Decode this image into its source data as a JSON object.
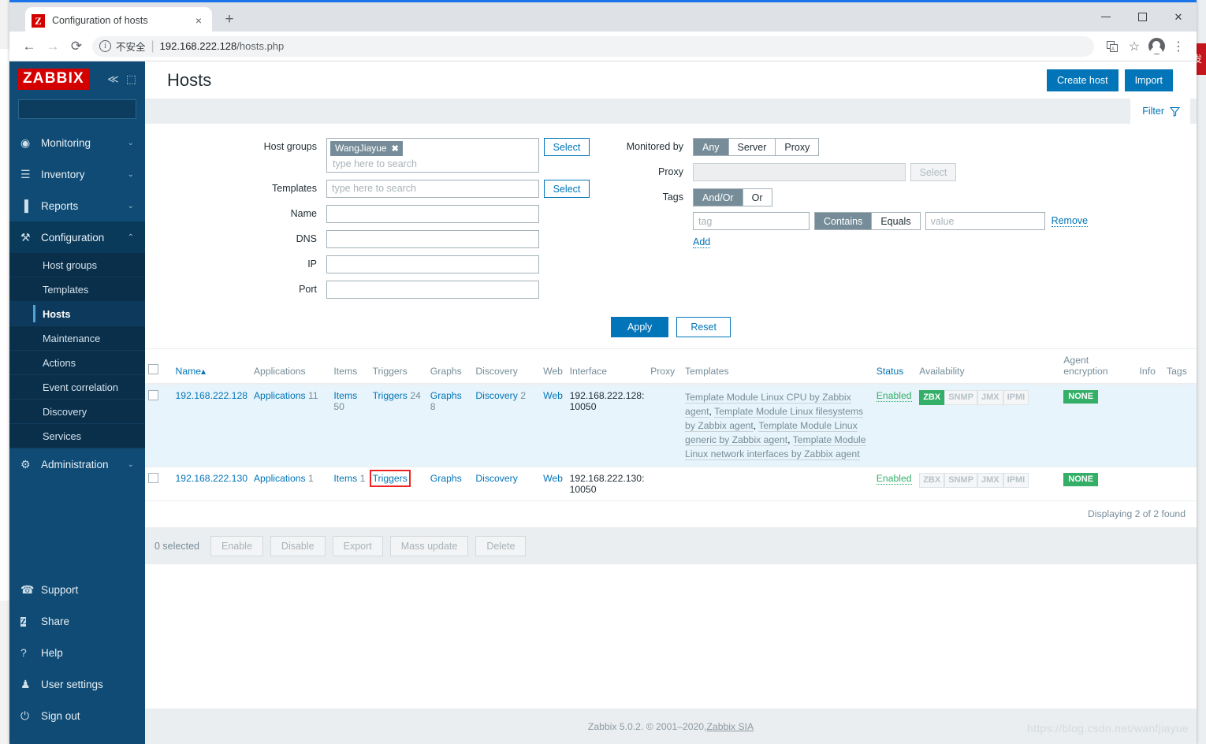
{
  "browser": {
    "tab_title": "Configuration of hosts",
    "tab_favicon": "Z",
    "close_tab": "×",
    "new_tab": "+",
    "back": "←",
    "forward": "→",
    "reload": "⟳",
    "info_icon": "i",
    "security_label": "不安全",
    "url_host": "192.168.222.128",
    "url_path": "/hosts.php",
    "translate_icon": "translate-icon",
    "bookmark_icon": "☆",
    "menu_icon": "⋮",
    "minimize": "—",
    "maximize": "□",
    "close": "✕"
  },
  "sidebar": {
    "logo": "ZABBIX",
    "collapse_icon": "≪",
    "hide_icon": "⬚",
    "search_placeholder": "",
    "search_value": "",
    "search_icon": "⌕",
    "items": [
      {
        "label": "Monitoring",
        "icon": "◉",
        "chevron": "⌄"
      },
      {
        "label": "Inventory",
        "icon": "☰",
        "chevron": "⌄"
      },
      {
        "label": "Reports",
        "icon": "▐",
        "chevron": "⌄"
      },
      {
        "label": "Configuration",
        "icon": "⚒",
        "chevron": "⌃"
      }
    ],
    "config_sub": [
      "Host groups",
      "Templates",
      "Hosts",
      "Maintenance",
      "Actions",
      "Event correlation",
      "Discovery",
      "Services"
    ],
    "current_sub": "Hosts",
    "administration": {
      "label": "Administration",
      "icon": "⚙",
      "chevron": "⌄"
    },
    "bottom": [
      {
        "label": "Support",
        "icon": "☎"
      },
      {
        "label": "Share",
        "icon": "Z"
      },
      {
        "label": "Help",
        "icon": "?"
      },
      {
        "label": "User settings",
        "icon": "♟"
      },
      {
        "label": "Sign out",
        "icon": "⏻"
      }
    ]
  },
  "header": {
    "title": "Hosts",
    "create_host": "Create host",
    "import": "Import"
  },
  "filter_tab": {
    "label": "Filter"
  },
  "filter": {
    "host_groups": {
      "label": "Host groups",
      "chips": [
        "WangJiayue"
      ],
      "chip_remove": "✖",
      "placeholder": "type here to search",
      "select_button": "Select"
    },
    "templates": {
      "label": "Templates",
      "placeholder": "type here to search",
      "value": "",
      "select_button": "Select"
    },
    "name": {
      "label": "Name",
      "value": ""
    },
    "dns": {
      "label": "DNS",
      "value": ""
    },
    "ip": {
      "label": "IP",
      "value": ""
    },
    "port": {
      "label": "Port",
      "value": ""
    },
    "monitored_by": {
      "label": "Monitored by",
      "options": [
        "Any",
        "Server",
        "Proxy"
      ],
      "selected": "Any"
    },
    "proxy": {
      "label": "Proxy",
      "value": "",
      "select_button": "Select"
    },
    "tags": {
      "label": "Tags",
      "logic_options": [
        "And/Or",
        "Or"
      ],
      "logic_selected": "And/Or",
      "tag_placeholder": "tag",
      "tag_value": "",
      "operator_options": [
        "Contains",
        "Equals"
      ],
      "operator_selected": "Contains",
      "value_placeholder": "value",
      "value_value": "",
      "remove_label": "Remove",
      "add_label": "Add"
    },
    "apply": "Apply",
    "reset": "Reset"
  },
  "table": {
    "columns": [
      "Name",
      "Applications",
      "Items",
      "Triggers",
      "Graphs",
      "Discovery",
      "Web",
      "Interface",
      "Proxy",
      "Templates",
      "Status",
      "Availability",
      "Agent encryption",
      "Info",
      "Tags"
    ],
    "sort_indicator": "▴",
    "rows": [
      {
        "name": "192.168.222.128",
        "applications": {
          "label": "Applications",
          "count": "11"
        },
        "items": {
          "label": "Items",
          "count": "50"
        },
        "triggers": {
          "label": "Triggers",
          "count": "24",
          "highlighted": false
        },
        "graphs": {
          "label": "Graphs",
          "count": "8"
        },
        "discovery": {
          "label": "Discovery",
          "count": "2"
        },
        "web": {
          "label": "Web",
          "count": ""
        },
        "interface": "192.168.222.128: 10050",
        "proxy": "",
        "templates": [
          "Template Module Linux CPU by Zabbix agent",
          "Template Module Linux filesystems by Zabbix agent",
          "Template Module Linux generic by Zabbix agent",
          "Template Module Linux network interfaces by Zabbix agent"
        ],
        "status": "Enabled",
        "availability": [
          {
            "label": "ZBX",
            "active": true
          },
          {
            "label": "SNMP",
            "active": false
          },
          {
            "label": "JMX",
            "active": false
          },
          {
            "label": "IPMI",
            "active": false
          }
        ],
        "agent_encryption": "NONE",
        "info": "",
        "tags": ""
      },
      {
        "name": "192.168.222.130",
        "applications": {
          "label": "Applications",
          "count": "1"
        },
        "items": {
          "label": "Items",
          "count": "1"
        },
        "triggers": {
          "label": "Triggers",
          "count": "",
          "highlighted": true
        },
        "graphs": {
          "label": "Graphs",
          "count": ""
        },
        "discovery": {
          "label": "Discovery",
          "count": ""
        },
        "web": {
          "label": "Web",
          "count": ""
        },
        "interface": "192.168.222.130: 10050",
        "proxy": "",
        "templates": [],
        "status": "Enabled",
        "availability": [
          {
            "label": "ZBX",
            "active": false
          },
          {
            "label": "SNMP",
            "active": false
          },
          {
            "label": "JMX",
            "active": false
          },
          {
            "label": "IPMI",
            "active": false
          }
        ],
        "agent_encryption": "NONE",
        "info": "",
        "tags": ""
      }
    ],
    "displaying": "Displaying 2 of 2 found"
  },
  "footer_actions": {
    "selected": "0 selected",
    "buttons": [
      "Enable",
      "Disable",
      "Export",
      "Mass update",
      "Delete"
    ]
  },
  "page_footer": {
    "text": "Zabbix 5.0.2. © 2001–2020, ",
    "link": "Zabbix SIA"
  },
  "watermark": "https://blog.csdn.net/wanfjiayue",
  "colors": {
    "brand_red": "#d40000",
    "sidebar_bg": "#0f4b74",
    "accent_blue": "#0275b8",
    "green": "#34af67",
    "highlight_red": "#ee2222"
  }
}
